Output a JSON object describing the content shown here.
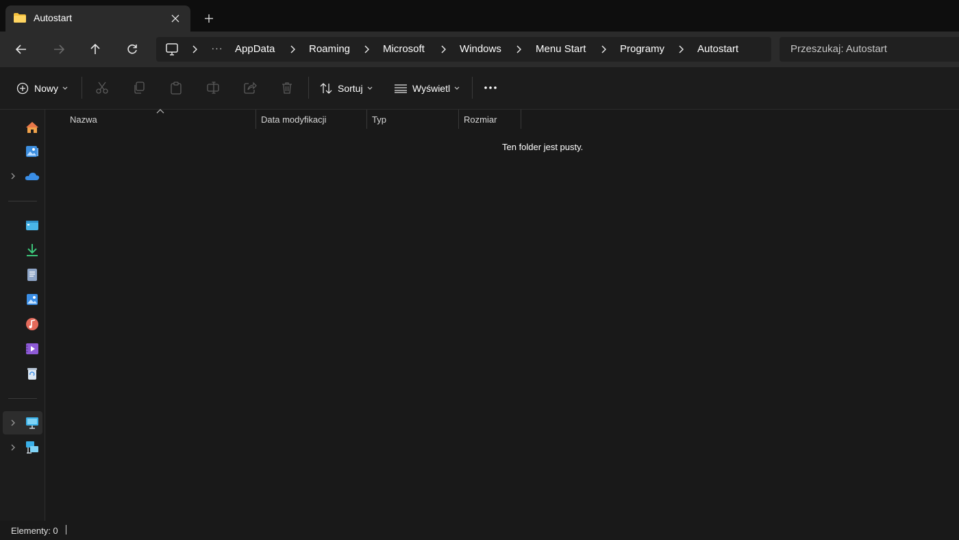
{
  "tab": {
    "title": "Autostart",
    "icon": "folder-icon",
    "close_icon": "close-icon",
    "new_tab_icon": "plus-icon"
  },
  "nav": {
    "back_icon": "arrow-left-icon",
    "forward_icon": "arrow-right-icon",
    "up_icon": "arrow-up-icon",
    "refresh_icon": "refresh-icon",
    "breadcrumb": {
      "root_icon": "this-pc-icon",
      "more": "···",
      "items": [
        "AppData",
        "Roaming",
        "Microsoft",
        "Windows",
        "Menu Start",
        "Programy",
        "Autostart"
      ]
    },
    "search_placeholder": "Przeszukaj: Autostart"
  },
  "command_bar": {
    "new_label": "Nowy",
    "sort_label": "Sortuj",
    "view_label": "Wyświetl",
    "more_icon": "more-icon",
    "disabled_icons": [
      "cut-icon",
      "copy-icon",
      "paste-icon",
      "rename-icon",
      "share-icon",
      "delete-icon"
    ]
  },
  "sidebar": {
    "items": [
      {
        "icon": "home-icon"
      },
      {
        "icon": "gallery-icon"
      },
      {
        "icon": "onedrive-icon",
        "expandable": true
      },
      {
        "icon": "desktop-icon"
      },
      {
        "icon": "downloads-icon"
      },
      {
        "icon": "documents-icon"
      },
      {
        "icon": "pictures-icon"
      },
      {
        "icon": "music-icon"
      },
      {
        "icon": "videos-icon"
      },
      {
        "icon": "recycle-bin-icon"
      },
      {
        "icon": "this-pc-icon",
        "expandable": true,
        "selected": true
      },
      {
        "icon": "network-icon",
        "expandable": true
      }
    ]
  },
  "columns": [
    "Nazwa",
    "Data modyfikacji",
    "Typ",
    "Rozmiar"
  ],
  "empty_message": "Ten folder jest pusty.",
  "status": {
    "items_count": "Elementy: 0"
  },
  "colors": {
    "background": "#1c1c1c",
    "titlebar": "#0e0e0e",
    "navbar": "#2b2b2b",
    "folder_yellow": "#f4c03c",
    "onedrive_blue": "#3a8ee6",
    "downloads_green": "#3cc67a"
  }
}
